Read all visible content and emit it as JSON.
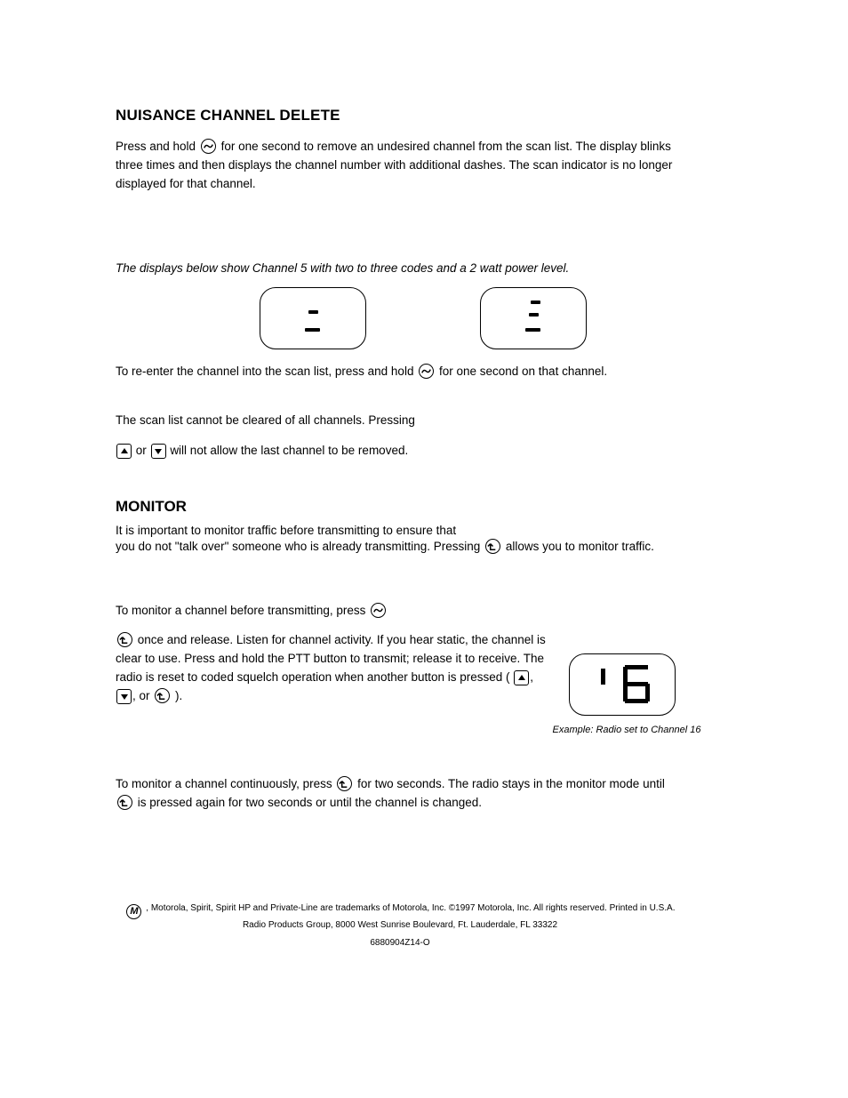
{
  "title": "NUISANCE CHANNEL DELETE",
  "para1": {
    "pre": "Press and hold ",
    "post1": " for one second to remove an undesired channel from the scan list. The display blinks three times and then displays the channel number with additional dashes. The scan indicator",
    "post2": " is no longer displayed for that channel."
  },
  "displays_note": "The displays below show Channel 5 with two to three codes and a 2 watt power level.",
  "para2": {
    "pre": "To re-enter the channel into the scan list, press and hold ",
    "post": " for one second on that channel."
  },
  "para3": {
    "pre_sentence": "The scan list cannot be cleared of all channels. Pressing ",
    "mid": "or",
    "post_sentence": " will not allow the last channel to be removed."
  },
  "monitor_title": "MONITOR",
  "monitor_para1": {
    "l1": "It is important to monitor traffic before transmitting to ensure that",
    "l2_pre": "you do not \"talk over\" someone who is already transmitting. Pressing ",
    "l2_post": " allows you to monitor traffic."
  },
  "monitor_para2": {
    "pre": "To monitor a channel before transmitting, press ",
    "post1": " once and release. Listen for channel activity. If you hear static, the channel is clear to use. Press and hold the PTT button to transmit; release it to receive. The radio is reset to coded squelch operation when another button is pressed (",
    "mid_comma": ",",
    "mid_or": ", or",
    "post2": ")."
  },
  "monitor_para3": {
    "pre": "To monitor a channel continuously, press ",
    "post": " for two seconds. The radio stays in the monitor mode until"
  },
  "monitor_para4": {
    "pre": "",
    "post": " is pressed again for two seconds or until the channel is changed."
  },
  "lcd_caption": "Example: Radio set to Channel 16",
  "footer": {
    "copyright_pre": ", Motorola, Spirit, Spirit HP and Private-Line are trademarks of Motorola, Inc. ©1997 Motorola, Inc. All rights reserved. Printed in U.S.A.",
    "address": "Radio Products Group, 8000 West Sunrise Boulevard, Ft. Lauderdale, FL 33322",
    "part": "6880904Z14-O"
  }
}
